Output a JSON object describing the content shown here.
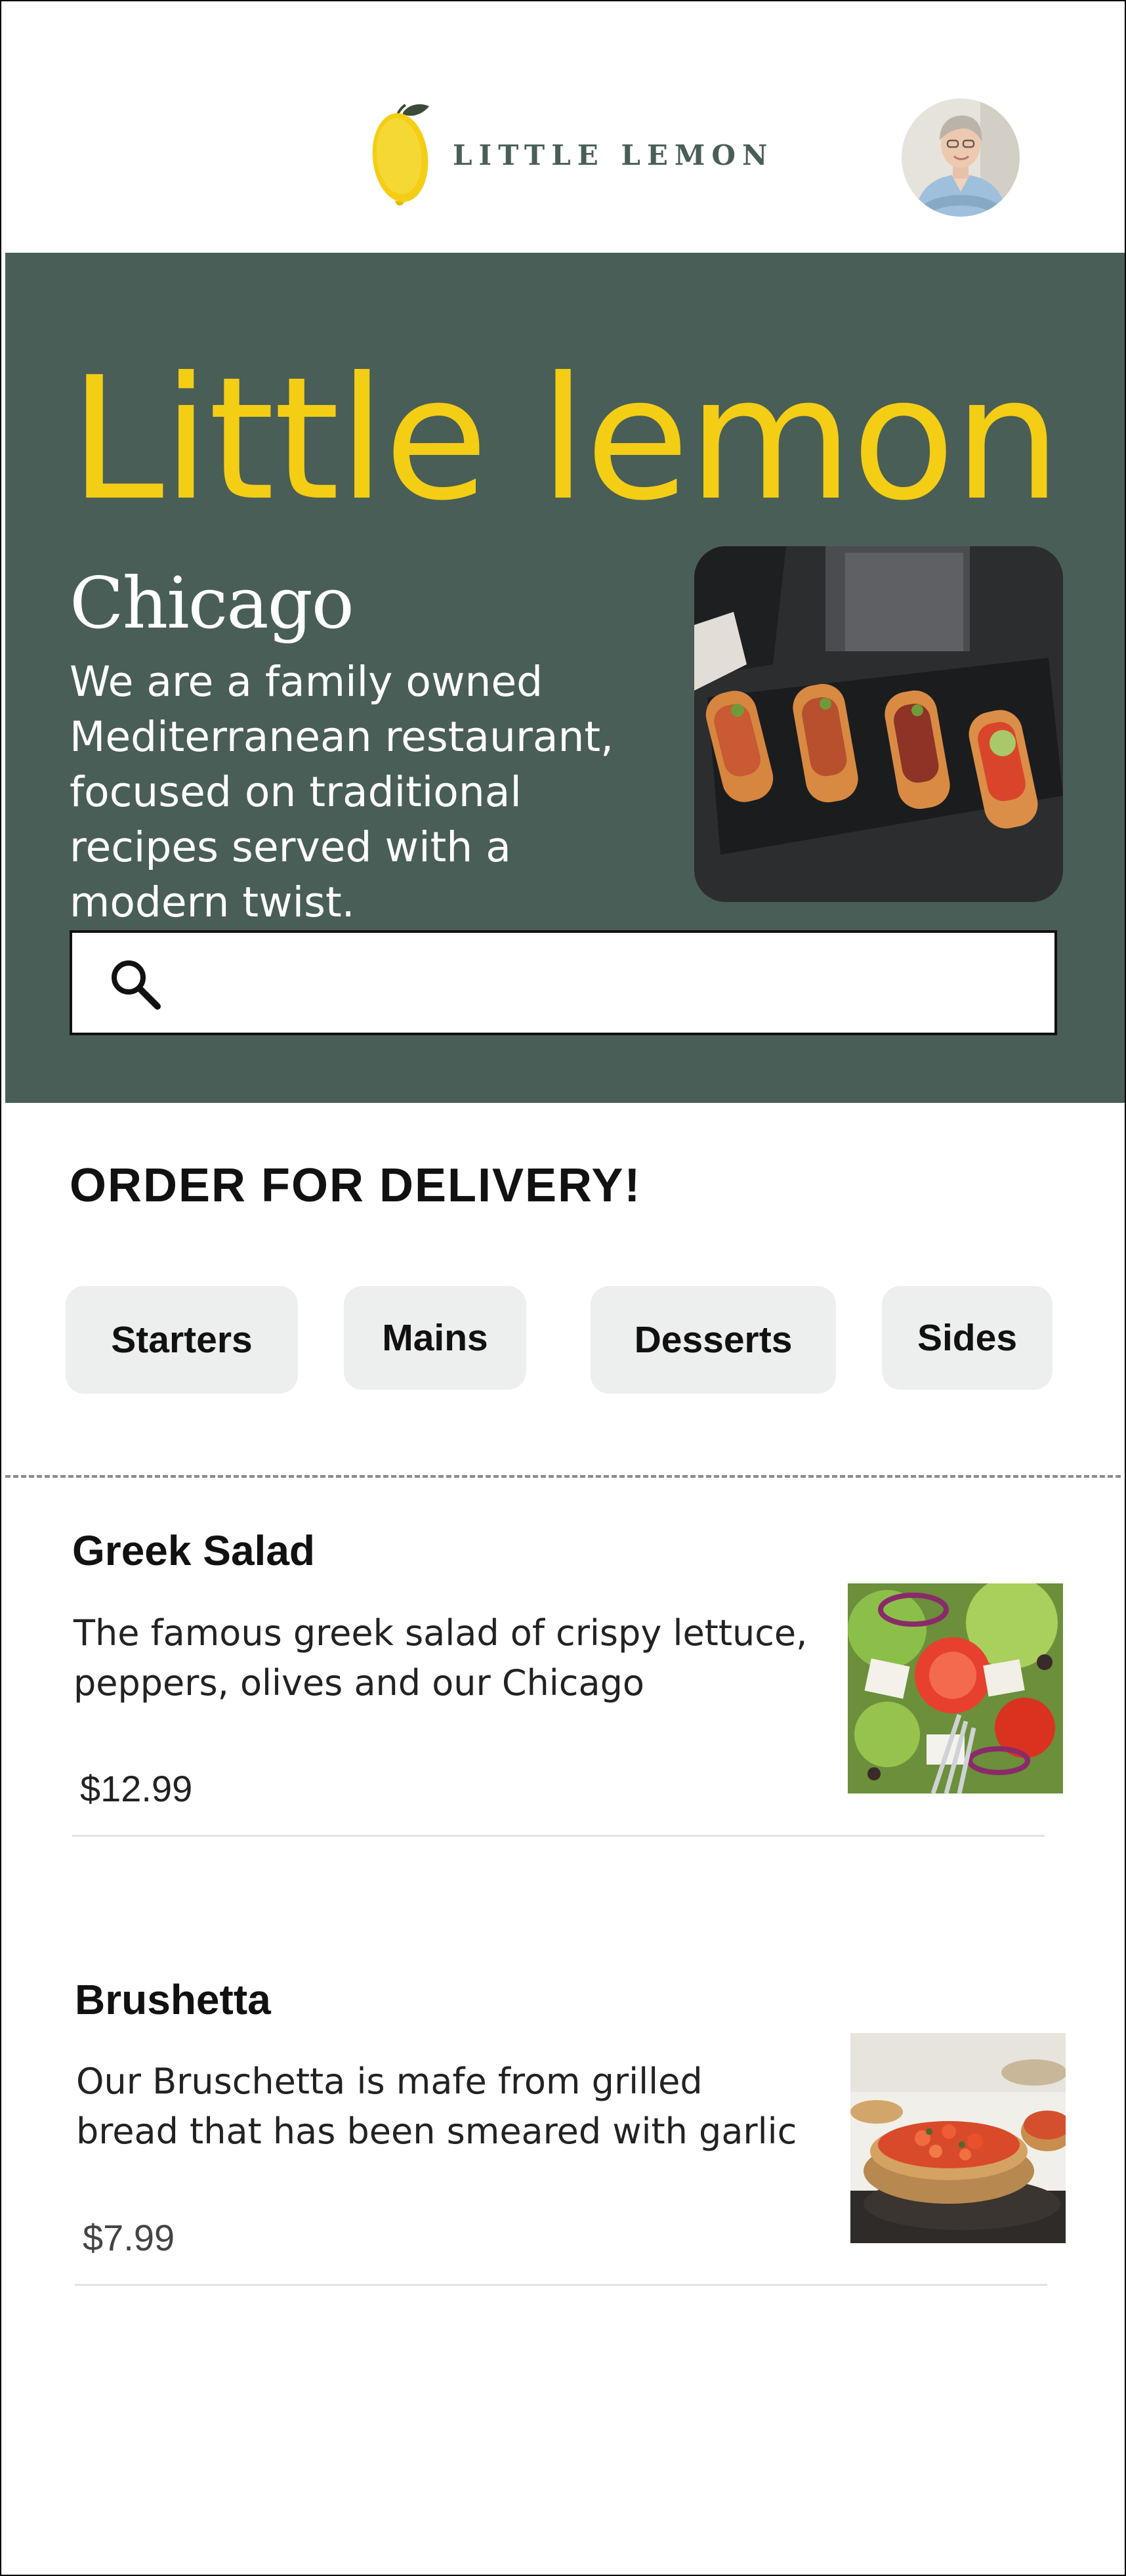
{
  "header": {
    "logo_text": "LITTLE LEMON",
    "logo_icon": "lemon-icon",
    "avatar_icon": "profile-avatar"
  },
  "hero": {
    "title": "Little lemon",
    "city": "Chicago",
    "description": "We are a family owned Mediterranean restaurant, focused on traditional recipes served with a modern twist.",
    "image_icon": "bruschetta-platter-image",
    "search_placeholder": "",
    "search_value": "",
    "search_icon": "search-icon"
  },
  "order": {
    "title": "ORDER FOR DELIVERY!",
    "categories": [
      "Starters",
      "Mains",
      "Desserts",
      "Sides"
    ]
  },
  "menu": {
    "items": [
      {
        "name": "Greek Salad",
        "description": "The famous greek salad of crispy lettuce, peppers, olives and our Chicago",
        "price": "$12.99",
        "image_icon": "greek-salad-image"
      },
      {
        "name": "Brushetta",
        "description": "Our Bruschetta is mafe from grilled bread that has been smeared with garlic",
        "price": "$7.99",
        "image_icon": "bruschetta-image"
      }
    ]
  },
  "colors": {
    "primary_green": "#495e57",
    "primary_yellow": "#f4ce14",
    "pill_bg": "#edefee"
  }
}
